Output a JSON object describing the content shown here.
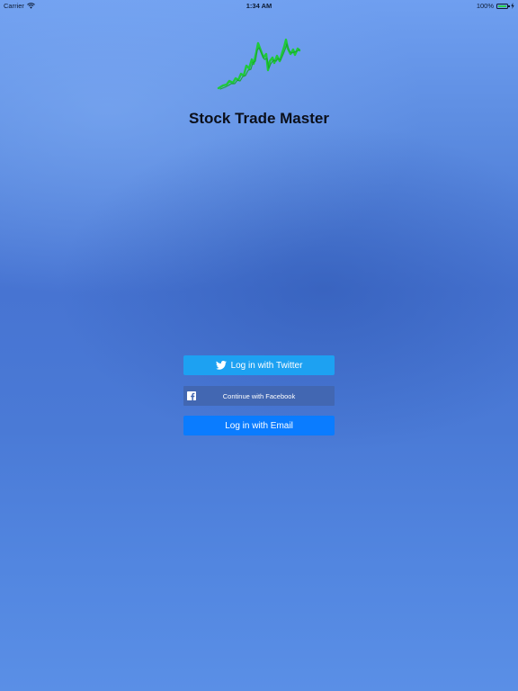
{
  "status_bar": {
    "carrier": "Carrier",
    "time": "1:34 AM",
    "battery": "100%",
    "battery_level": 1.0
  },
  "app": {
    "title": "Stock Trade Master",
    "logo_icon": "stock-chart-logo-icon",
    "logo_color": "#1fc93a"
  },
  "buttons": {
    "twitter_label": "Log in with Twitter",
    "twitter_color": "#1da1f2",
    "facebook_label": "Continue with Facebook",
    "facebook_color": "#4267b2",
    "email_label": "Log in with Email",
    "email_color": "#0a7cff"
  }
}
